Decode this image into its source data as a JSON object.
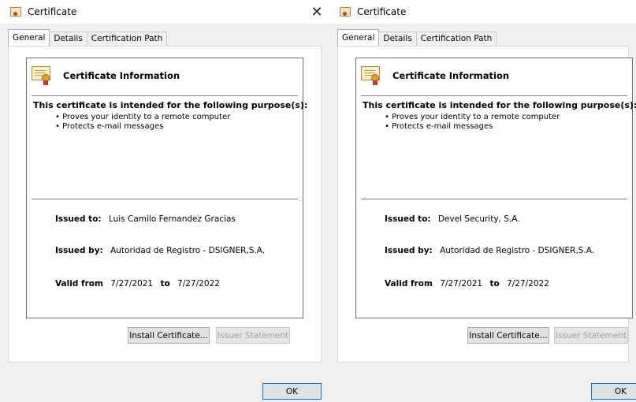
{
  "dialogs": [
    {
      "title": "Certificate",
      "close_glyph": "✕",
      "tabs": [
        "General",
        "Details",
        "Certification Path"
      ],
      "info_title": "Certificate Information",
      "purpose_heading": "This certificate is intended for the following purpose(s):",
      "purposes": [
        "• Proves your identity to a remote computer",
        "• Protects e-mail messages"
      ],
      "issued_to_label": "Issued to:",
      "issued_to": "Luis Camilo Fernandez Gracias",
      "issued_by_label": "Issued by:",
      "issued_by": "Autoridad de Registro - DSIGNER,S.A.",
      "valid_from_label": "Valid from",
      "valid_from": "7/27/2021",
      "valid_to_label": "to",
      "valid_to": "7/27/2022",
      "install_label": "Install Certificate...",
      "issuer_label": "Issuer Statement",
      "ok_label": "OK"
    },
    {
      "title": "Certificate",
      "tabs": [
        "General",
        "Details",
        "Certification Path"
      ],
      "info_title": "Certificate Information",
      "purpose_heading": "This certificate is intended for the following purpose(s):",
      "purposes": [
        "• Proves your identity to a remote computer",
        "• Protects e-mail messages"
      ],
      "issued_to_label": "Issued to:",
      "issued_to": "Devel Security, S.A.",
      "issued_by_label": "Issued by:",
      "issued_by": "Autoridad de Registro - DSIGNER,S.A.",
      "valid_from_label": "Valid from",
      "valid_from": "7/27/2021",
      "valid_to_label": "to",
      "valid_to": "7/27/2022",
      "install_label": "Install Certificate...",
      "issuer_label": "Issuer Statement",
      "ok_label": "OK"
    }
  ]
}
